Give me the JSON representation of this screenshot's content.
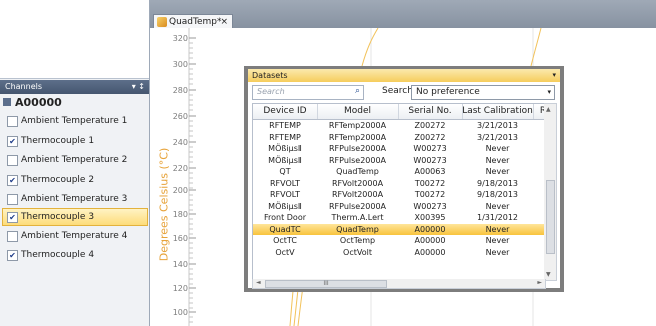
{
  "channels": {
    "title": "Channels",
    "header_controls": "▾ ↕",
    "root": "A00000",
    "items": [
      {
        "label": "Ambient Temperature 1",
        "checked": false,
        "check": ""
      },
      {
        "label": "Thermocouple 1",
        "checked": true,
        "check": "✔"
      },
      {
        "label": "Ambient Temperature 2",
        "checked": false,
        "check": ""
      },
      {
        "label": "Thermocouple 2",
        "checked": true,
        "check": "✔"
      },
      {
        "label": "Ambient Temperature 3",
        "checked": false,
        "check": ""
      },
      {
        "label": "Thermocouple 3",
        "checked": true,
        "check": "✔",
        "selected": true
      },
      {
        "label": "Ambient Temperature 4",
        "checked": false,
        "check": ""
      },
      {
        "label": "Thermocouple 4",
        "checked": true,
        "check": "✔"
      }
    ]
  },
  "document": {
    "tab_label": "QuadTemp*",
    "tab_close": "×",
    "icon": "chart-doc-icon"
  },
  "plot": {
    "ylabel": "Degrees Celsius (°C)",
    "yticks": [
      "320",
      "300",
      "280",
      "260",
      "240",
      "220",
      "200",
      "180",
      "160",
      "140",
      "120",
      "100"
    ]
  },
  "datasets": {
    "title": "Datasets",
    "title_menu": "▾",
    "search_placeholder": "Search",
    "search_icon": "⌕",
    "search_by_label": "Search by:",
    "search_by_value": "No preference",
    "search_by_arrow": "▾",
    "columns": [
      "Device ID",
      "Model",
      "Serial No.",
      "Last Calibration",
      "R"
    ],
    "rows": [
      [
        "RFTEMP",
        "RFTemp2000A",
        "Z00272",
        "3/21/2013"
      ],
      [
        "RFTEMP",
        "RFTemp2000A",
        "Z00272",
        "3/21/2013"
      ],
      [
        "MÖßiµsⅡ",
        "RFPulse2000A",
        "W00273",
        "Never"
      ],
      [
        "MÖßiµsⅡ",
        "RFPulse2000A",
        "W00273",
        "Never"
      ],
      [
        "QT",
        "QuadTemp",
        "A00063",
        "Never"
      ],
      [
        "RFVOLT",
        "RFVolt2000A",
        "T00272",
        "9/18/2013"
      ],
      [
        "RFVOLT",
        "RFVolt2000A",
        "T00272",
        "9/18/2013"
      ],
      [
        "MÖßiµsⅡ",
        "RFPulse2000A",
        "W00273",
        "Never"
      ],
      [
        "Front Door",
        "Therm.A.Lert",
        "X00395",
        "1/31/2012"
      ],
      [
        "QuadTC",
        "QuadTemp",
        "A00000",
        "Never"
      ],
      [
        "OctTC",
        "OctTemp",
        "A00000",
        "Never"
      ],
      [
        "OctV",
        "OctVolt",
        "A00000",
        "Never"
      ]
    ],
    "selected_row": 9,
    "hscroll_grip": "III"
  },
  "colors": {
    "selection": "#f8c33d",
    "axis_label": "#e7a33a",
    "curve": "#f2c25a"
  }
}
